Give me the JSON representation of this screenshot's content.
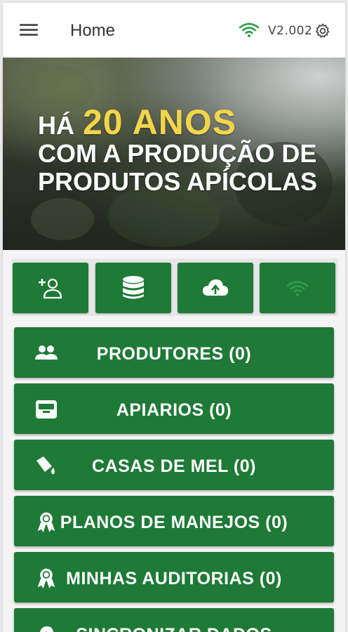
{
  "header": {
    "title": "Home",
    "version": "V2.002",
    "wifi_icon": "wifi-icon",
    "settings_icon": "gear-icon",
    "menu_icon": "hamburger-menu-icon"
  },
  "hero": {
    "line1_prefix": "HÁ",
    "line1_accent": "20 ANOS",
    "line2": "COM A PRODUÇÃO DE",
    "line3": "PRODUTOS APÍCOLAS",
    "accent_color": "#f3d54a"
  },
  "quick_actions": [
    {
      "icon": "add-user-icon"
    },
    {
      "icon": "database-icon"
    },
    {
      "icon": "cloud-upload-icon"
    },
    {
      "icon": "wifi-icon"
    }
  ],
  "menu": [
    {
      "label": "PRODUTORES (0)",
      "icon": "users-icon"
    },
    {
      "label": "APIARIOS (0)",
      "icon": "archive-box-icon"
    },
    {
      "label": "CASAS DE MEL (0)",
      "icon": "paint-bucket-icon"
    },
    {
      "label": "PLANOS DE MANEJOS (0)",
      "icon": "award-ribbon-icon"
    },
    {
      "label": "MINHAS AUDITORIAS (0)",
      "icon": "award-ribbon-icon"
    },
    {
      "label": "SINCRONIZAR DADOS",
      "icon": "cloud-upload-icon"
    }
  ],
  "colors": {
    "primary_green": "#1e7a36",
    "wifi_green": "#2e9e4a"
  }
}
